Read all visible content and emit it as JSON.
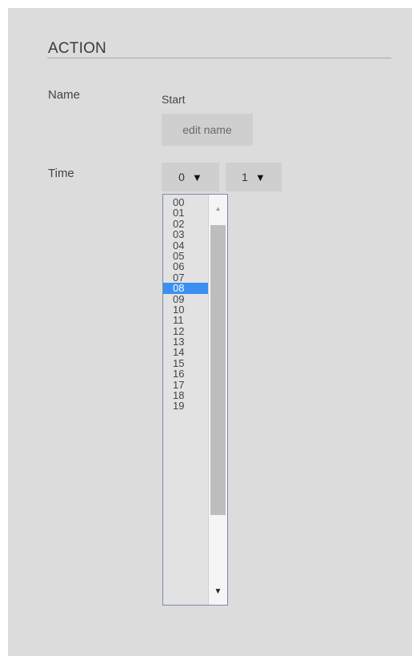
{
  "action": {
    "title": "ACTION",
    "name_label": "Name",
    "name_value": "Start",
    "edit_name_label": "edit name",
    "time_label": "Time",
    "hour_select": {
      "value": "0",
      "arrow_icon": "triangle-down-icon"
    },
    "minute_select": {
      "value": "1",
      "arrow_icon": "triangle-down-icon"
    }
  },
  "hour_dropdown": {
    "options": [
      "00",
      "01",
      "02",
      "03",
      "04",
      "05",
      "06",
      "07",
      "08",
      "09",
      "10",
      "11",
      "12",
      "13",
      "14",
      "15",
      "16",
      "17",
      "18",
      "19"
    ],
    "selected_index": 8,
    "scroll_up_icon": "scroll-up-arrow-icon",
    "scroll_down_icon": "scroll-down-arrow-icon",
    "colors": {
      "selected_bg": "#3b8ff0",
      "selected_text": "#ffffff"
    }
  }
}
